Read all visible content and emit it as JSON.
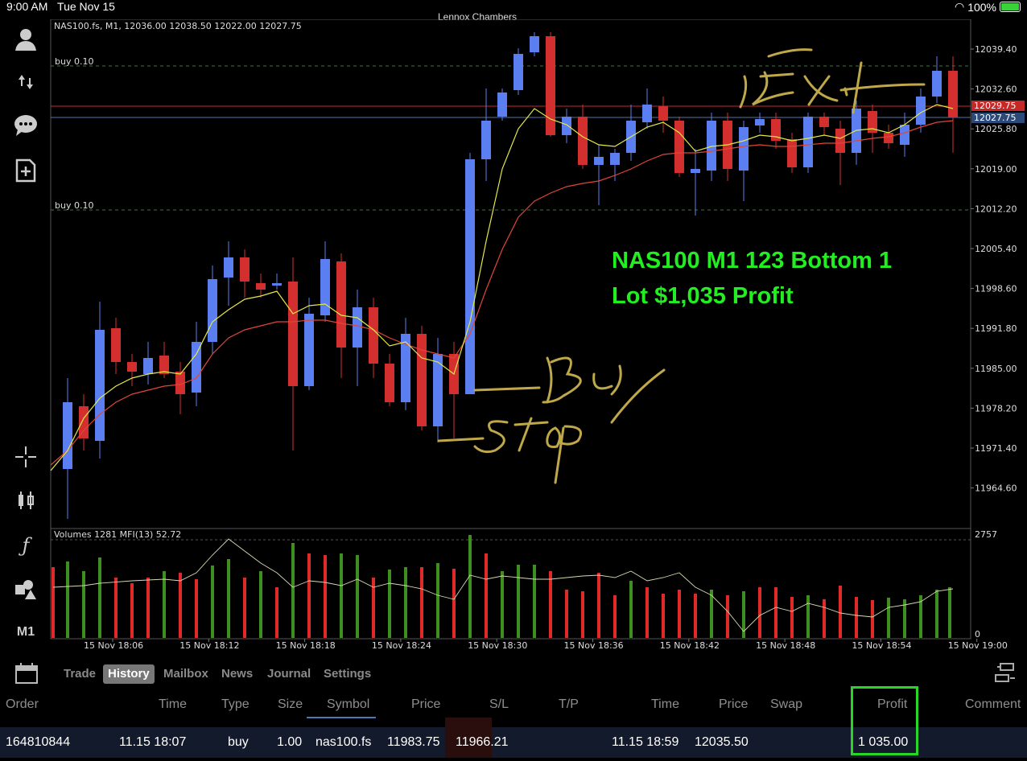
{
  "status": {
    "time": "9:00 AM",
    "date": "Tue Nov 15",
    "account": "Lennox Chambers",
    "battery": "100%"
  },
  "chart": {
    "header": "NAS100.fs, M1, 12036.00 12038.50 12022.00 12027.75",
    "buy_label_1": "buy 0.10",
    "buy_label_2": "buy 0.10",
    "annotation_line1": "NAS100 M1 123 Bottom 1",
    "annotation_line2": "Lot $1,035 Profit",
    "handwritten": [
      "Exit",
      "Buy",
      "Stop"
    ],
    "price_ticks": [
      "12039.40",
      "12032.60",
      "12025.80",
      "12019.00",
      "12012.20",
      "12005.40",
      "11998.60",
      "11991.80",
      "11985.00",
      "11978.20",
      "11971.40",
      "11964.60"
    ],
    "red_line_label": "12029.75",
    "blue_line_label": "12027.75",
    "volume_header": "Volumes 1281 MFI(13) 52.72",
    "volume_max": "2757",
    "volume_min": "0",
    "time_ticks": [
      "15 Nov 18:06",
      "15 Nov 18:12",
      "15 Nov 18:18",
      "15 Nov 18:24",
      "15 Nov 18:30",
      "15 Nov 18:36",
      "15 Nov 18:42",
      "15 Nov 18:48",
      "15 Nov 18:54",
      "15 Nov 19:00"
    ],
    "timeframe": "M1"
  },
  "tabs": [
    {
      "label": "Trade"
    },
    {
      "label": "History"
    },
    {
      "label": "Mailbox"
    },
    {
      "label": "News"
    },
    {
      "label": "Journal"
    },
    {
      "label": "Settings"
    }
  ],
  "history": {
    "headers": {
      "order": "Order",
      "time": "Time",
      "type": "Type",
      "size": "Size",
      "symbol": "Symbol",
      "price": "Price",
      "sl": "S/L",
      "tp": "T/P",
      "time2": "Time",
      "price2": "Price",
      "swap": "Swap",
      "profit": "Profit",
      "comment": "Comment"
    },
    "row": {
      "order": "164810844",
      "time": "11.15 18:07",
      "type": "buy",
      "size": "1.00",
      "symbol": "nas100.fs",
      "price": "11983.75",
      "sl": "11966.21",
      "time2": "11.15 18:59",
      "price2": "12035.50",
      "profit": "1 035.00"
    }
  },
  "colors": {
    "bull": "#5b7ff0",
    "bear": "#d32f2f",
    "ema_fast": "#e6e64a",
    "ema_slow": "#e0463a",
    "vol_up": "#3f8f1f",
    "vol_down": "#e02a2a",
    "highlight": "#27d627",
    "handwriting": "#bfa84a"
  }
}
